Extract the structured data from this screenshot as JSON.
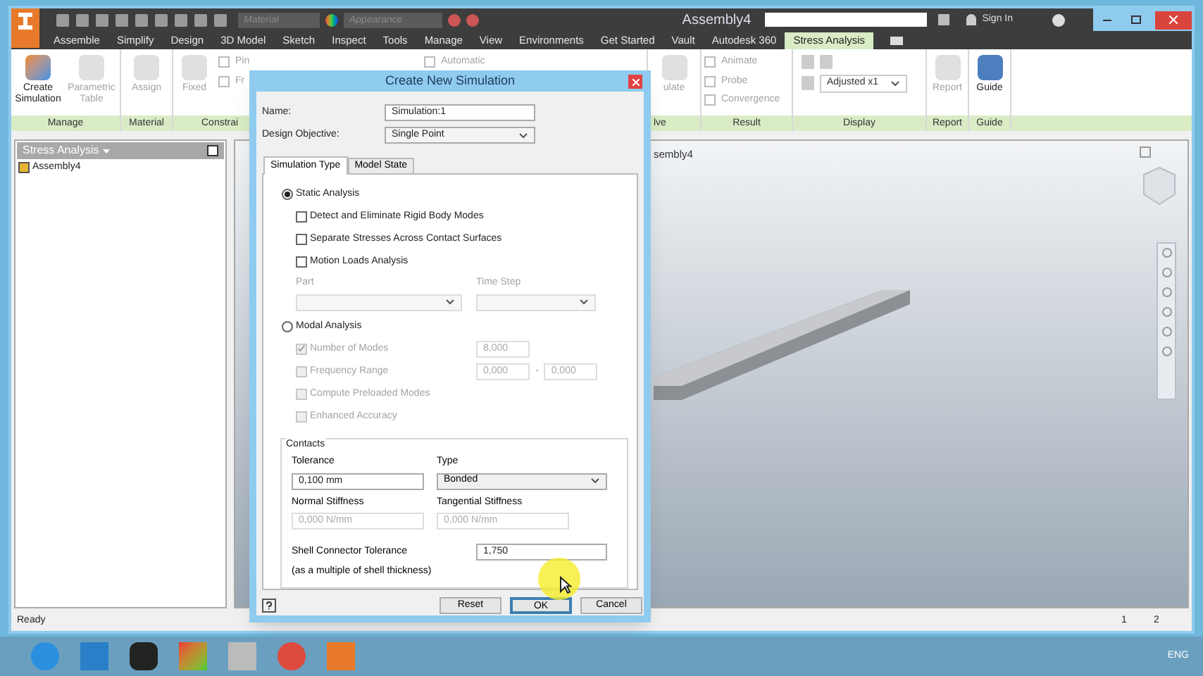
{
  "window": {
    "title": "Assembly4",
    "material_combo": "Material",
    "appearance_combo": "Appearance",
    "sign_in": "Sign In"
  },
  "menu_tabs": [
    {
      "label": "Assemble",
      "selected": false
    },
    {
      "label": "Simplify",
      "selected": false
    },
    {
      "label": "Design",
      "selected": false
    },
    {
      "label": "3D Model",
      "selected": false
    },
    {
      "label": "Sketch",
      "selected": false
    },
    {
      "label": "Inspect",
      "selected": false
    },
    {
      "label": "Tools",
      "selected": false
    },
    {
      "label": "Manage",
      "selected": false
    },
    {
      "label": "View",
      "selected": false
    },
    {
      "label": "Environments",
      "selected": false
    },
    {
      "label": "Get Started",
      "selected": false
    },
    {
      "label": "Vault",
      "selected": false
    },
    {
      "label": "Autodesk 360",
      "selected": false
    },
    {
      "label": "Stress Analysis",
      "selected": true
    }
  ],
  "ribbon": [
    {
      "label": "Manage",
      "buttons": [
        {
          "label": "Create Simulation",
          "disabled": false
        },
        {
          "label": "Parametric Table",
          "disabled": true
        }
      ]
    },
    {
      "label": "Material",
      "buttons": [
        {
          "label": "Assign",
          "disabled": true
        }
      ]
    },
    {
      "label": "Constrai",
      "buttons": [
        {
          "label": "Fixed",
          "disabled": true
        }
      ],
      "columns": [
        [
          {
            "label": "Pin",
            "disabled": true
          },
          {
            "label": "Fr",
            "disabled": true
          }
        ],
        [
          {
            "label": "Automatic",
            "disabled": true
          }
        ]
      ]
    },
    {
      "label": "lve",
      "buttons": [
        {
          "label": "ulate",
          "disabled": true
        }
      ]
    },
    {
      "label": "Result",
      "columns": [
        [
          {
            "label": "Animate",
            "disabled": true
          },
          {
            "label": "Probe",
            "disabled": true
          },
          {
            "label": "Convergence",
            "disabled": true
          }
        ]
      ]
    },
    {
      "label": "Display",
      "dropdown": "Adjusted x1"
    },
    {
      "label": "Report",
      "buttons": [
        {
          "label": "Report",
          "disabled": true
        }
      ]
    },
    {
      "label": "Guide",
      "buttons": [
        {
          "label": "Guide",
          "disabled": false
        }
      ]
    }
  ],
  "browser": {
    "title": "Stress Analysis",
    "items": [
      {
        "label": "Assembly4"
      }
    ]
  },
  "viewport": {
    "label": "sembly4"
  },
  "dialog": {
    "title": "Create New Simulation",
    "name_label": "Name:",
    "name_value": "Simulation:1",
    "objective_label": "Design Objective:",
    "objective_value": "Single Point",
    "tabs": [
      {
        "label": "Simulation Type",
        "selected": true
      },
      {
        "label": "Model State",
        "selected": false
      }
    ],
    "options": [
      {
        "kind": "radio",
        "label": "Static Analysis",
        "selected": true
      },
      {
        "kind": "checkbox",
        "label": "Detect and Eliminate Rigid Body Modes",
        "checked": false,
        "disabled": false
      },
      {
        "kind": "checkbox",
        "label": "Separate Stresses Across Contact Surfaces",
        "checked": false,
        "disabled": false
      },
      {
        "kind": "checkbox",
        "label": "Motion Loads Analysis",
        "checked": false,
        "disabled": false
      },
      {
        "kind": "selects",
        "labels": [
          "Part",
          "Time Step"
        ],
        "disabled": true
      },
      {
        "kind": "radio",
        "label": "Modal Analysis",
        "selected": false
      },
      {
        "kind": "checkbox",
        "label": "Number of Modes",
        "checked": true,
        "disabled": true,
        "fields": [
          "8,000"
        ]
      },
      {
        "kind": "checkbox",
        "label": "Frequency Range",
        "checked": false,
        "disabled": true,
        "fields": [
          "0,000",
          "0,000"
        ],
        "separator": "-"
      },
      {
        "kind": "checkbox",
        "label": "Compute Preloaded Modes",
        "checked": false,
        "disabled": true
      },
      {
        "kind": "checkbox",
        "label": "Enhanced Accuracy",
        "checked": false,
        "disabled": true
      }
    ],
    "contacts": {
      "title": "Contacts",
      "tolerance_label": "Tolerance",
      "tolerance_value": "0,100 mm",
      "type_label": "Type",
      "type_value": "Bonded",
      "normal_label": "Normal Stiffness",
      "normal_value": "0,000 N/mm",
      "tangential_label": "Tangential Stiffness",
      "tangential_value": "0,000 N/mm",
      "stiffness_disabled": true,
      "shell_label": "Shell Connector Tolerance",
      "shell_note": "(as a multiple of shell thickness)",
      "shell_value": "1,750"
    },
    "buttons": [
      {
        "label": "Reset",
        "default": false
      },
      {
        "label": "OK",
        "default": true
      },
      {
        "label": "Cancel",
        "default": false
      }
    ]
  },
  "status_bar": {
    "text": "Ready",
    "pages": [
      "1",
      "2"
    ]
  },
  "taskbar": {
    "language": "ENG"
  }
}
